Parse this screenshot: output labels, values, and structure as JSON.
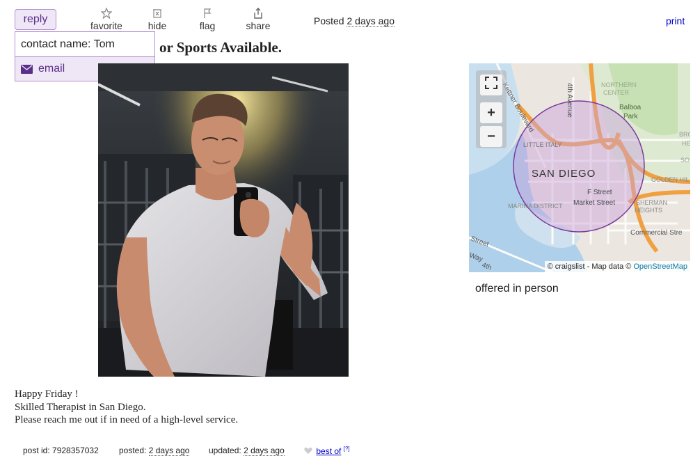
{
  "toolbar": {
    "reply_label": "reply",
    "favorite_label": "favorite",
    "hide_label": "hide",
    "flag_label": "flag",
    "share_label": "share",
    "posted_prefix": "Posted",
    "posted_value": "2 days ago",
    "print_label": "print"
  },
  "reply_popup": {
    "contact_label": "contact name: Tom",
    "email_label": "email"
  },
  "post": {
    "title_visible": "or Sports Available.",
    "body_lines": [
      "Happy Friday !",
      "Skilled Therapist in San Diego.",
      "Please reach me out if in need of a high-level service."
    ],
    "offered": "offered in person"
  },
  "map": {
    "city_label": "SAN DIEGO",
    "labels": {
      "kettner": "Kettner Boulevard",
      "fourth": "4th Avenue",
      "northern": "NORTHERN",
      "center": "CENTER",
      "balboa": "Balboa",
      "park": "Park",
      "little_italy": "LITTLE ITALY",
      "f_street": "F Street",
      "market": "Market Street",
      "marina": "MARINA DISTRICT",
      "golden": "GOLDEN HIL",
      "sherman": "SHERMAN",
      "heights": "HEIGHTS",
      "commercial": "Commercial Stre",
      "street": "Street",
      "way": "Way",
      "fourth_short": "4th",
      "bro": "BRO",
      "he": "HE",
      "so": "SO"
    },
    "attribution_prefix": "© craigslist - Map data ©",
    "attribution_link": "OpenStreetMap",
    "fullscreen_icon": "fullscreen-icon",
    "zoom_in": "+",
    "zoom_out": "−"
  },
  "footer": {
    "post_id": "post id: 7928357032",
    "posted_prefix": "posted:",
    "posted_value": "2 days ago",
    "updated_prefix": "updated:",
    "updated_value": "2 days ago",
    "best_of": "best of",
    "best_of_sup": "[?]"
  },
  "icons": {
    "favorite": "star-icon",
    "hide": "hide-icon",
    "flag": "flag-icon",
    "share": "share-icon",
    "email": "envelope-icon",
    "heart": "heart-icon"
  },
  "colors": {
    "accent_purple": "#5a2f8a",
    "accent_border": "#b58fd1",
    "link_blue": "#0000cc"
  }
}
